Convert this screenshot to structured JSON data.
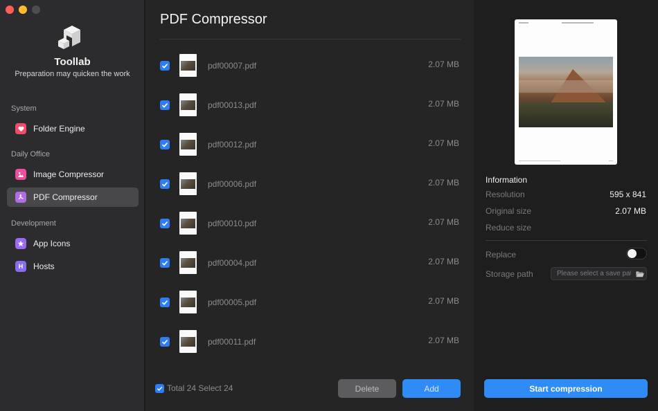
{
  "app": {
    "name": "Toollab",
    "tagline": "Preparation may quicken the work"
  },
  "sidebar": {
    "sections": [
      {
        "label": "System",
        "items": [
          {
            "label": "Folder Engine",
            "icon": "heart-icon",
            "color": "#ef4e6b"
          }
        ]
      },
      {
        "label": "Daily Office",
        "items": [
          {
            "label": "Image Compressor",
            "icon": "image-icon",
            "color": "#ec4f9c"
          },
          {
            "label": "PDF Compressor",
            "icon": "pdf-icon",
            "color": "#b26ce8",
            "active": true
          }
        ]
      },
      {
        "label": "Development",
        "items": [
          {
            "label": "App Icons",
            "icon": "star-icon",
            "color": "#9b6bf2"
          },
          {
            "label": "Hosts",
            "icon": "h-icon",
            "color": "#8a6cf0",
            "glyph": "H"
          }
        ]
      }
    ]
  },
  "main": {
    "title": "PDF Compressor",
    "files": [
      {
        "name": "pdf00007.pdf",
        "size": "2.07 MB",
        "checked": true
      },
      {
        "name": "pdf00013.pdf",
        "size": "2.07 MB",
        "checked": true
      },
      {
        "name": "pdf00012.pdf",
        "size": "2.07 MB",
        "checked": true
      },
      {
        "name": "pdf00006.pdf",
        "size": "2.07 MB",
        "checked": true
      },
      {
        "name": "pdf00010.pdf",
        "size": "2.07 MB",
        "checked": true
      },
      {
        "name": "pdf00004.pdf",
        "size": "2.07 MB",
        "checked": true
      },
      {
        "name": "pdf00005.pdf",
        "size": "2.07 MB",
        "checked": true
      },
      {
        "name": "pdf00011.pdf",
        "size": "2.07 MB",
        "checked": true
      }
    ],
    "footer": {
      "total_text": "Total 24 Select 24",
      "delete_label": "Delete",
      "add_label": "Add"
    }
  },
  "panel": {
    "info_title": "Information",
    "resolution_label": "Resolution",
    "resolution_value": "595 x 841",
    "original_label": "Original size",
    "original_value": "2.07 MB",
    "reduce_label": "Reduce size",
    "reduce_value": "",
    "replace_label": "Replace",
    "replace_on": false,
    "storage_label": "Storage path",
    "storage_placeholder": "Please select a save path",
    "start_label": "Start compression"
  },
  "colors": {
    "accent": "#2f8cf7",
    "checkbox": "#2f7df6",
    "sidebar_bg": "#2c2c2e",
    "list_bg": "#252526",
    "panel_bg": "#1e1e1e"
  }
}
